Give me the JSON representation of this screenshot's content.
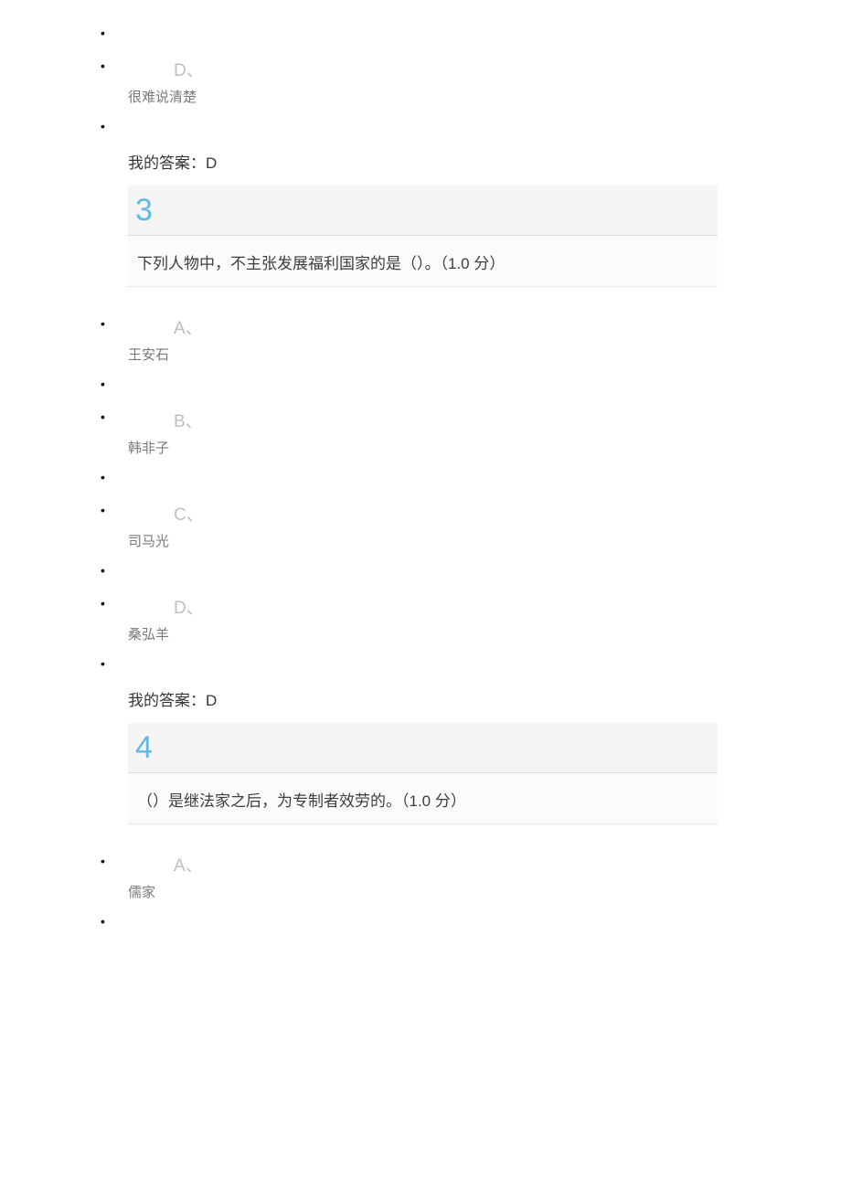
{
  "q2": {
    "option_d_letter": "D、",
    "option_d_text": "很难说清楚",
    "answer": "我的答案：D"
  },
  "q3": {
    "number": "3",
    "text": "下列人物中，不主张发展福利国家的是（）。（1.0 分）",
    "a_letter": "A、",
    "a_text": "王安石",
    "b_letter": "B、",
    "b_text": "韩非子",
    "c_letter": "C、",
    "c_text": "司马光",
    "d_letter": "D、",
    "d_text": "桑弘羊",
    "answer": "我的答案：D"
  },
  "q4": {
    "number": "4",
    "text": "（）是继法家之后，为专制者效劳的。（1.0 分）",
    "a_letter": "A、",
    "a_text": "儒家"
  }
}
